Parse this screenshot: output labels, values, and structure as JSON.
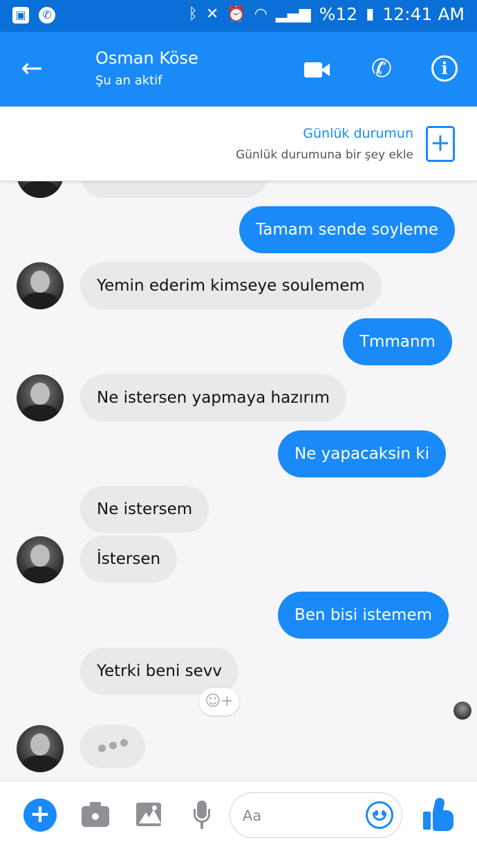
{
  "status_bar": {
    "battery": "%12",
    "time": "12:41 AM",
    "icons": [
      "gallery-icon",
      "whatsapp-icon",
      "bluetooth-icon",
      "mute-icon",
      "alarm-icon",
      "wifi-icon",
      "signal-icon",
      "battery-icon"
    ]
  },
  "header": {
    "back_icon": "arrow-left-icon",
    "contact_name": "Osman Köse",
    "contact_status": "Şu an aktif",
    "actions": [
      "video-call-icon",
      "phone-icon",
      "info-icon"
    ]
  },
  "story": {
    "title": "Günlük durumun",
    "subtitle": "Günlük durumuna bir şey ekle",
    "add_icon": "plus-square-icon"
  },
  "messages": [
    {
      "side": "out",
      "text": "Tamam sende soyleme"
    },
    {
      "side": "in",
      "text": "Yemin ederim kimseye soulemem"
    },
    {
      "side": "out",
      "text": "Tmmanm"
    },
    {
      "side": "in",
      "text": "Ne istersen yapmaya hazırım"
    },
    {
      "side": "out",
      "text": "Ne yapacaksin ki"
    },
    {
      "side": "in",
      "text": "Ne istersem"
    },
    {
      "side": "in",
      "text": "İstersen"
    },
    {
      "side": "out",
      "text": "Ben bisi istemem"
    },
    {
      "side": "in",
      "text": "Yetrki beni sevv"
    }
  ],
  "composer": {
    "placeholder": "Aa",
    "icons": [
      "plus-icon",
      "camera-icon",
      "image-icon",
      "microphone-icon",
      "emoji-icon",
      "thumbs-up-icon"
    ]
  },
  "colors": {
    "status_bar": "#0a6fd6",
    "accent": "#1a8af8",
    "incoming_bubble": "#e9e9ec",
    "background": "#f6f6f8"
  }
}
